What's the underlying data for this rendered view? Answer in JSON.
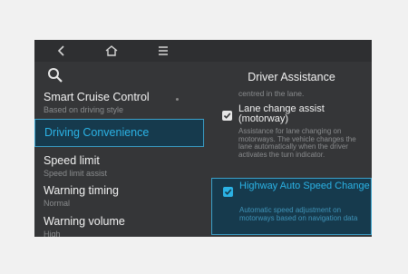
{
  "nav": {
    "back_icon": "back-chevron-icon",
    "home_icon": "home-icon",
    "menu_icon": "menu-icon"
  },
  "search": {
    "icon": "search-icon"
  },
  "left_menu": {
    "items": [
      {
        "title": "Smart Cruise Control",
        "subtitle": "Based on driving style"
      },
      {
        "title": "Driving Convenience",
        "subtitle": ""
      },
      {
        "title": "Speed limit",
        "subtitle": "Speed limit assist"
      },
      {
        "title": "Warning timing",
        "subtitle": "Normal"
      },
      {
        "title": "Warning volume",
        "subtitle": "High"
      }
    ]
  },
  "right_panel": {
    "title": "Driver Assistance",
    "fragment": "centred in the lane.",
    "options": [
      {
        "title": "Lane change assist (motorway)",
        "description": "Assistance for lane changing on motorways. The vehicle changes the lane automatically when the driver activates the turn indicator.",
        "checked": true
      },
      {
        "title": "Highway Auto Speed Change",
        "description": "Automatic speed adjustment on motorways based on navigation data",
        "checked": true
      }
    ]
  },
  "colors": {
    "accent": "#2bb3e6",
    "selection_bg": "#163a4d",
    "screen_bg": "#353638"
  }
}
